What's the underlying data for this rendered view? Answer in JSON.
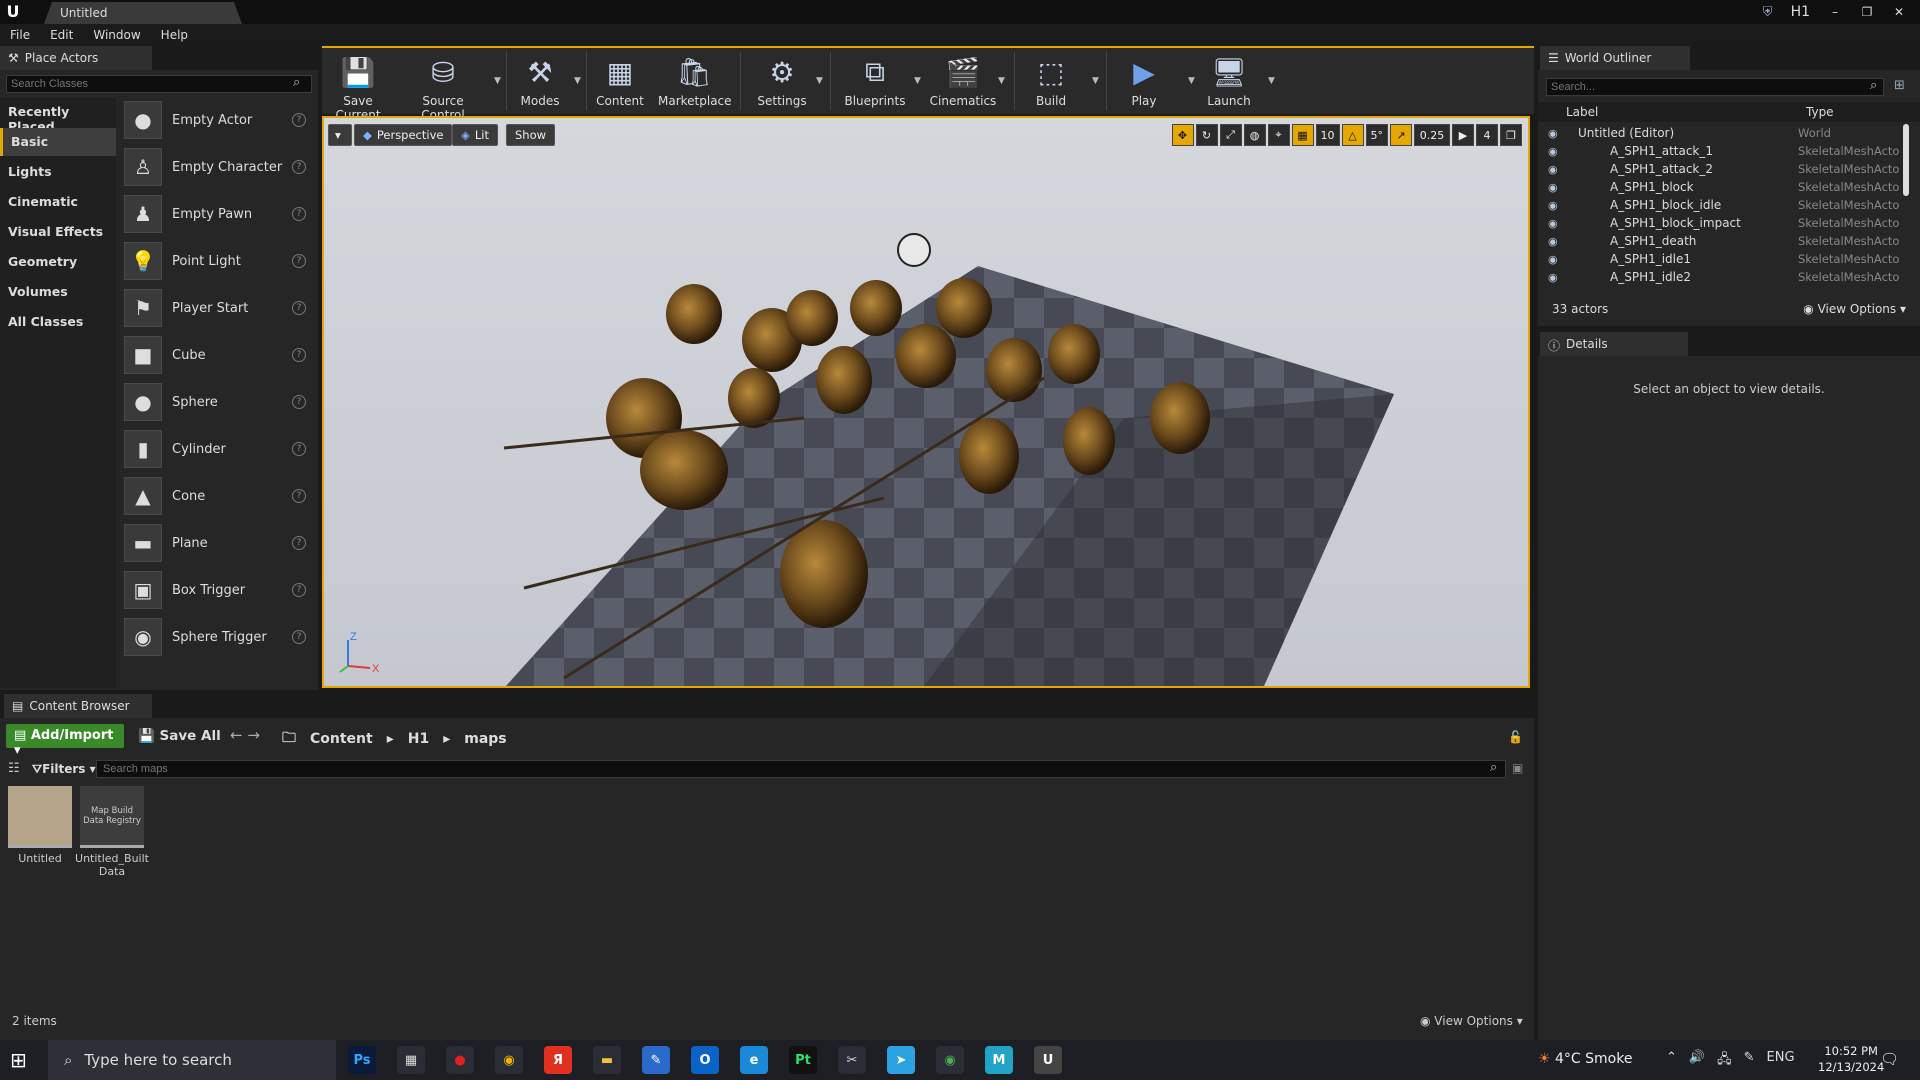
{
  "window": {
    "title": "Untitled",
    "project": "H1"
  },
  "menu": [
    "File",
    "Edit",
    "Window",
    "Help"
  ],
  "place_actors": {
    "tab": "Place Actors",
    "search_placeholder": "Search Classes",
    "categories": [
      "Recently Placed",
      "Basic",
      "Lights",
      "Cinematic",
      "Visual Effects",
      "Geometry",
      "Volumes",
      "All Classes"
    ],
    "active_category": "Basic",
    "actors": [
      {
        "name": "Empty Actor",
        "icon": "sphere-icon"
      },
      {
        "name": "Empty Character",
        "icon": "character-icon"
      },
      {
        "name": "Empty Pawn",
        "icon": "pawn-icon"
      },
      {
        "name": "Point Light",
        "icon": "light-bulb-icon"
      },
      {
        "name": "Player Start",
        "icon": "player-start-icon"
      },
      {
        "name": "Cube",
        "icon": "cube-icon"
      },
      {
        "name": "Sphere",
        "icon": "sphere-icon"
      },
      {
        "name": "Cylinder",
        "icon": "cylinder-icon"
      },
      {
        "name": "Cone",
        "icon": "cone-icon"
      },
      {
        "name": "Plane",
        "icon": "plane-icon"
      },
      {
        "name": "Box Trigger",
        "icon": "box-trigger-icon"
      },
      {
        "name": "Sphere Trigger",
        "icon": "sphere-trigger-icon"
      }
    ]
  },
  "toolbar": {
    "items": [
      {
        "label": "Save Current",
        "icon": "save-icon"
      },
      {
        "label": "Source Control",
        "icon": "source-control-icon"
      },
      {
        "label": "Modes",
        "icon": "modes-icon"
      },
      {
        "label": "Content",
        "icon": "content-icon"
      },
      {
        "label": "Marketplace",
        "icon": "marketplace-icon"
      },
      {
        "label": "Settings",
        "icon": "settings-icon"
      },
      {
        "label": "Blueprints",
        "icon": "blueprints-icon"
      },
      {
        "label": "Cinematics",
        "icon": "cinematics-icon"
      },
      {
        "label": "Build",
        "icon": "build-icon"
      },
      {
        "label": "Play",
        "icon": "play-icon"
      },
      {
        "label": "Launch",
        "icon": "launch-icon"
      }
    ]
  },
  "viewport": {
    "perspective_label": "Perspective",
    "lit_label": "Lit",
    "show_label": "Show",
    "grid_snap": "10",
    "rotation_snap": "5°",
    "scale_snap": "0.25",
    "camera_speed": "4",
    "axis_labels": {
      "z": "Z",
      "x": "X"
    }
  },
  "outliner": {
    "tab": "World Outliner",
    "search_placeholder": "Search...",
    "col_label": "Label",
    "col_type": "Type",
    "rows": [
      {
        "label": "Untitled (Editor)",
        "type": "World"
      },
      {
        "label": "A_SPH1_attack_1",
        "type": "SkeletalMeshActo"
      },
      {
        "label": "A_SPH1_attack_2",
        "type": "SkeletalMeshActo"
      },
      {
        "label": "A_SPH1_block",
        "type": "SkeletalMeshActo"
      },
      {
        "label": "A_SPH1_block_idle",
        "type": "SkeletalMeshActo"
      },
      {
        "label": "A_SPH1_block_impact",
        "type": "SkeletalMeshActo"
      },
      {
        "label": "A_SPH1_death",
        "type": "SkeletalMeshActo"
      },
      {
        "label": "A_SPH1_idle1",
        "type": "SkeletalMeshActo"
      },
      {
        "label": "A_SPH1_idle2",
        "type": "SkeletalMeshActo"
      }
    ],
    "actor_count": "33 actors",
    "view_options": "View Options"
  },
  "details": {
    "tab": "Details",
    "message": "Select an object to view details."
  },
  "content_browser": {
    "tab": "Content Browser",
    "add_import": "Add/Import",
    "save_all": "Save All",
    "breadcrumbs": [
      "Content",
      "H1",
      "maps"
    ],
    "filters": "Filters",
    "search_placeholder": "Search maps",
    "assets": [
      {
        "name": "Untitled",
        "thumb_text": ""
      },
      {
        "name": "Untitled_Built Data",
        "thumb_text": "Map Build Data Registry"
      }
    ],
    "item_count": "2 items",
    "view_options": "View Options"
  },
  "taskbar": {
    "search_placeholder": "Type here to search",
    "weather": "4°C  Smoke",
    "lang": "ENG",
    "time": "10:52 PM",
    "date": "12/13/2024",
    "apps": [
      {
        "label": "Ps",
        "color": "#0a1a3a",
        "fg": "#31a8ff"
      },
      {
        "label": "▦",
        "color": "#2a2d36",
        "fg": "#ddd"
      },
      {
        "label": "●",
        "color": "#2a2d36",
        "fg": "#e02020"
      },
      {
        "label": "◉",
        "color": "#2a2d36",
        "fg": "#f4b400"
      },
      {
        "label": "Я",
        "color": "#e0301e",
        "fg": "#fff"
      },
      {
        "label": "▬",
        "color": "#2a2d36",
        "fg": "#f0c040"
      },
      {
        "label": "✎",
        "color": "#2a6ac8",
        "fg": "#fff"
      },
      {
        "label": "O",
        "color": "#0a64c8",
        "fg": "#fff"
      },
      {
        "label": "e",
        "color": "#1a8ad8",
        "fg": "#fff"
      },
      {
        "label": "Pt",
        "color": "#111",
        "fg": "#2de36c"
      },
      {
        "label": "✂",
        "color": "#2a2d36",
        "fg": "#ddd"
      },
      {
        "label": "➤",
        "color": "#2aa3e0",
        "fg": "#fff"
      },
      {
        "label": "◉",
        "color": "#2a2d36",
        "fg": "#4caf50"
      },
      {
        "label": "M",
        "color": "#23a3c8",
        "fg": "#fff"
      },
      {
        "label": "U",
        "color": "#444",
        "fg": "#fff"
      }
    ]
  }
}
